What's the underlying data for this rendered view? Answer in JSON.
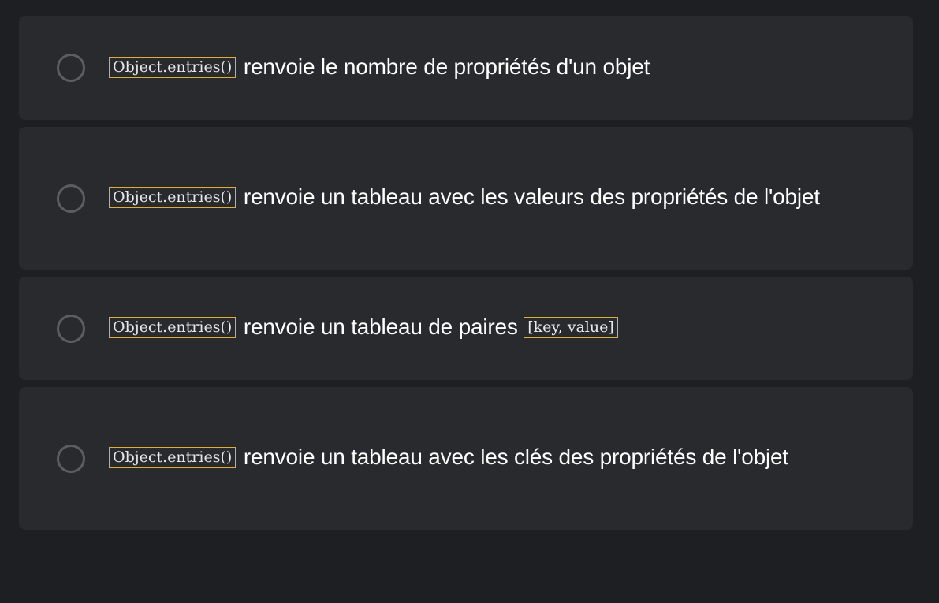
{
  "options": [
    {
      "code": "Object.entries()",
      "text": "renvoie le nombre de propriétés d'un objet",
      "selected": false
    },
    {
      "code": "Object.entries()",
      "text": "renvoie un tableau avec les valeurs des propriétés de l'objet",
      "selected": false
    },
    {
      "code": "Object.entries()",
      "text": "renvoie un tableau de paires",
      "code2": "[key, value]",
      "selected": false
    },
    {
      "code": "Object.entries()",
      "text": "renvoie un tableau avec les clés des propriétés de l'objet",
      "selected": false
    }
  ],
  "colors": {
    "background": "#1d1f23",
    "card": "#292a2e",
    "code_border": "#d9b03a",
    "radio_border": "#5c5d61"
  }
}
